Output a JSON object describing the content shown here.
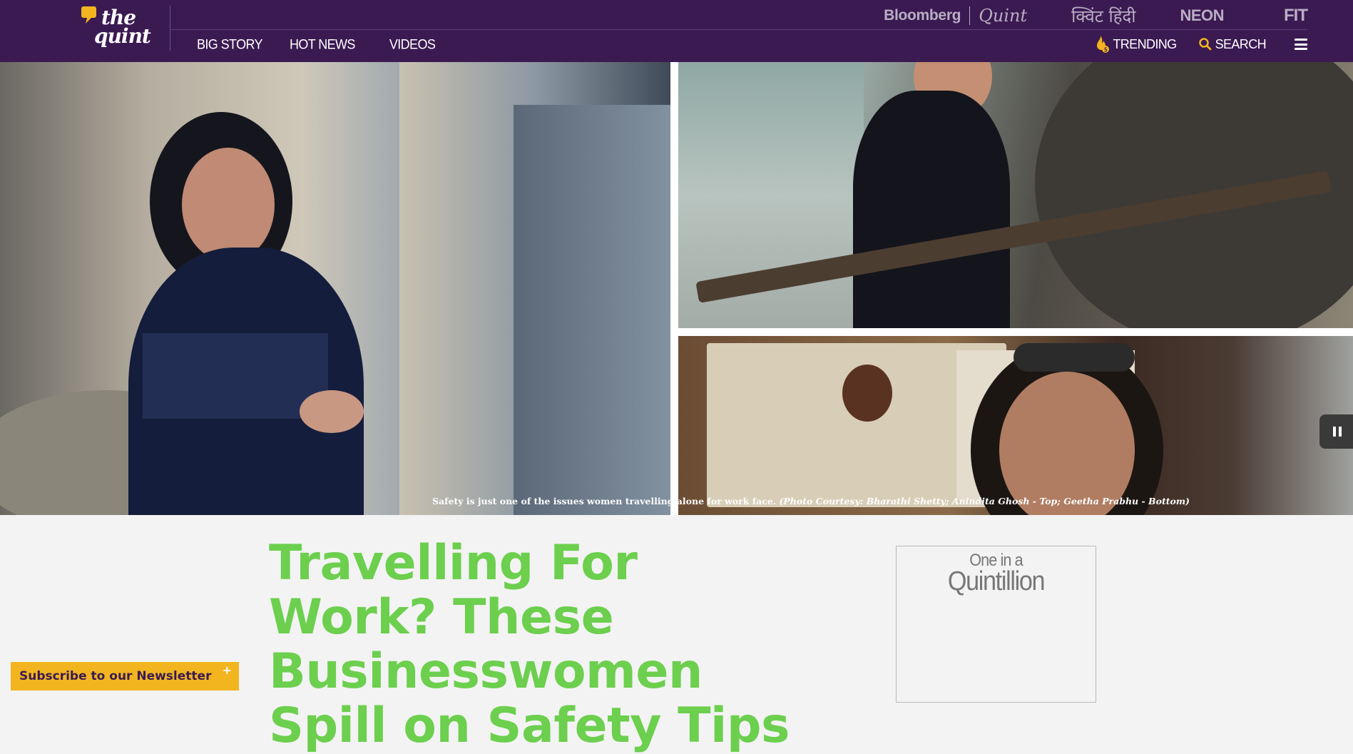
{
  "header": {
    "logo": {
      "line1": "the",
      "line2": "quint"
    },
    "partners": [
      {
        "label": "Bloomberg"
      },
      {
        "label": "Quint"
      },
      {
        "label": "क्विंट हिंदी"
      },
      {
        "label": "NEON"
      },
      {
        "label": "FIT"
      }
    ],
    "nav": [
      {
        "label": "BIG STORY"
      },
      {
        "label": "HOT NEWS"
      },
      {
        "label": "VIDEOS"
      }
    ],
    "tools": {
      "trending_label": "TRENDING",
      "trending_badge": "5",
      "search_label": "SEARCH",
      "menu_icon": "hamburger-icon"
    },
    "colors": {
      "header_bg": "#3b1a52",
      "accent_yellow": "#f2b51f",
      "headline_green": "#6ccf4e"
    }
  },
  "hero": {
    "caption_main": "Safety is just one of the issues women travelling alone for work face.",
    "caption_credit": "(Photo Courtesy: Bharathi Shetty; Anindita Ghosh - Top; Geetha Prabhu - Bottom)",
    "pause_icon": "pause-icon"
  },
  "article": {
    "headline": "Travelling For Work? These Businesswomen Spill on Safety Tips"
  },
  "promo": {
    "line1": "One in a",
    "line2": "Quintillion"
  },
  "newsletter": {
    "label": "Subscribe to our Newsletter",
    "plus": "+"
  }
}
